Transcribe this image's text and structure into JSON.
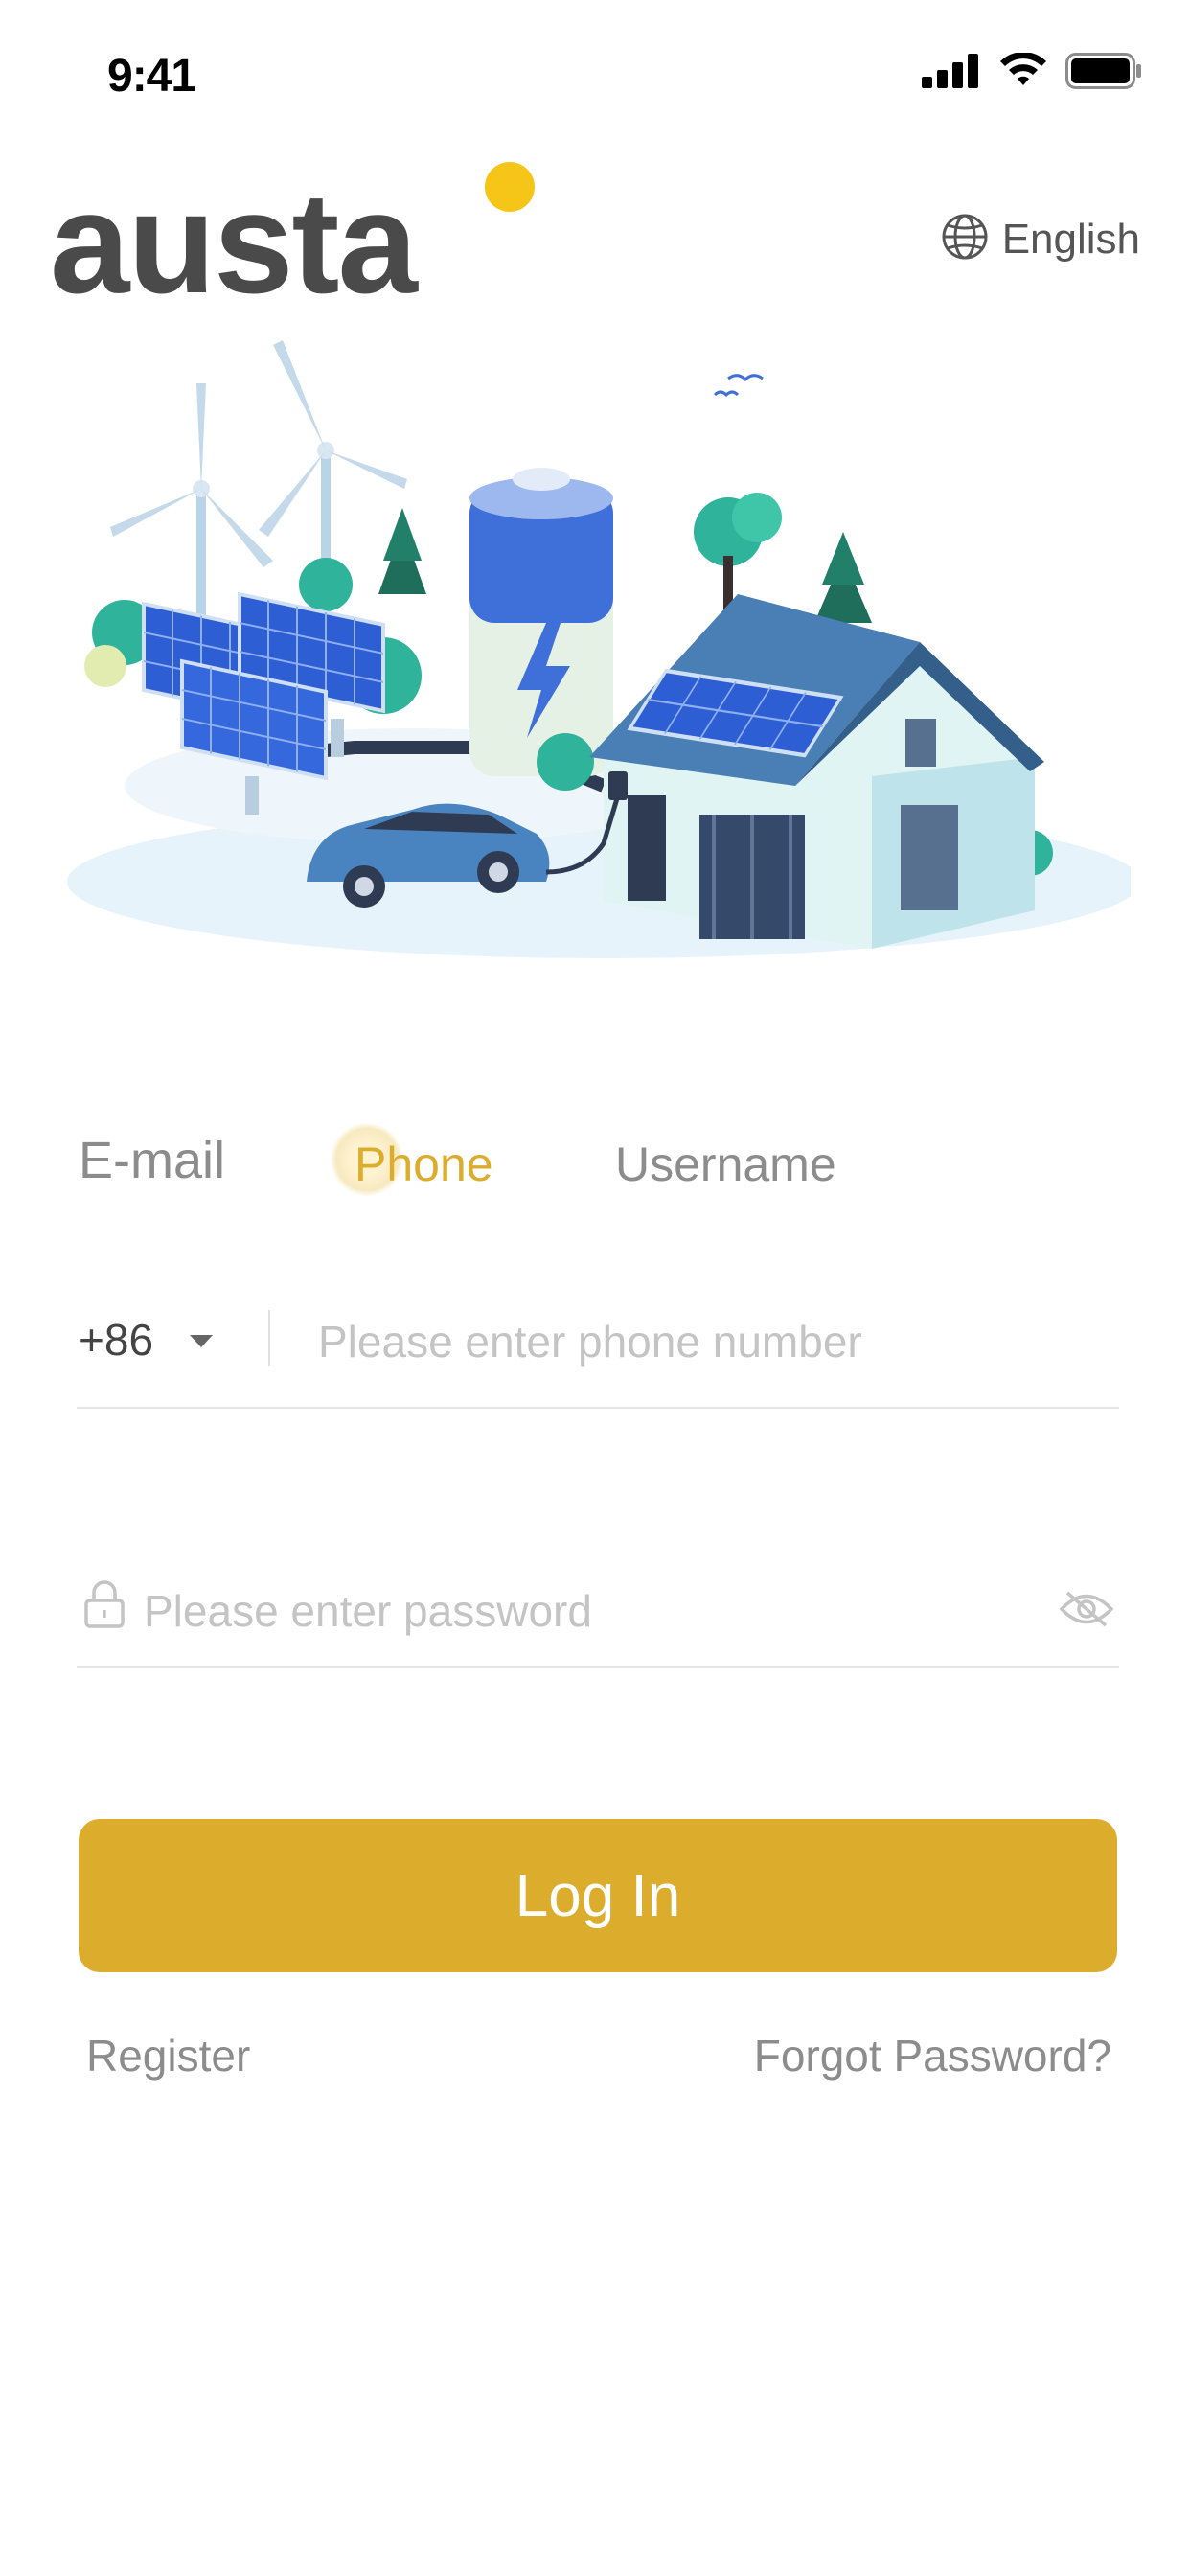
{
  "status_bar": {
    "time": "9:41"
  },
  "header": {
    "logo_text": "austa",
    "language": "English"
  },
  "login_tabs": [
    {
      "label": "E-mail",
      "active": false
    },
    {
      "label": "Phone",
      "active": true
    },
    {
      "label": "Username",
      "active": false
    }
  ],
  "phone_field": {
    "country_code": "+86",
    "placeholder": "Please enter phone number",
    "value": ""
  },
  "password_field": {
    "placeholder": "Please enter password",
    "value": ""
  },
  "actions": {
    "login_label": "Log In",
    "register_label": "Register",
    "forgot_label": "Forgot Password?"
  },
  "colors": {
    "accent": "#dcad2d",
    "text_muted": "#8c8c8c",
    "logo_text": "#4a4a4a",
    "logo_dot": "#f5c518",
    "illustration_blue": "#3f6fd9"
  },
  "icons": [
    "signal-icon",
    "wifi-icon",
    "battery-icon",
    "globe-icon",
    "caret-down-icon",
    "lock-icon",
    "eye-off-icon"
  ]
}
